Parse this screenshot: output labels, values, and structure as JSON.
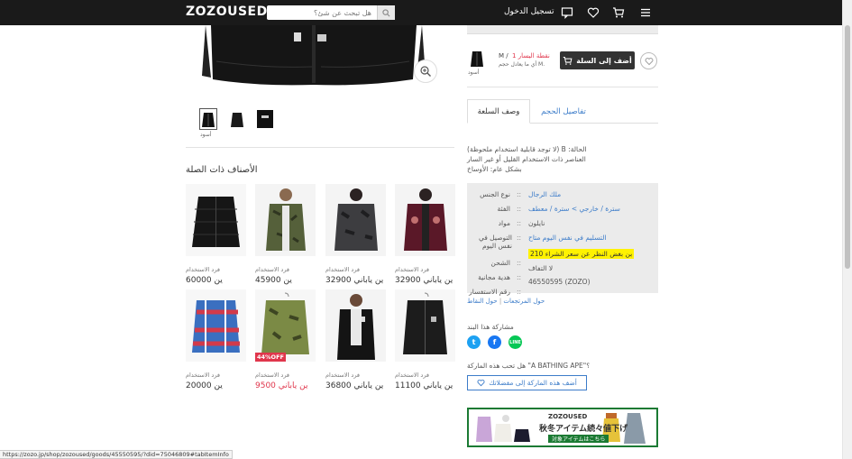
{
  "header": {
    "logo": "ZOZOUSED",
    "search_placeholder": "هل تبحث عن شئ؟",
    "login": "تسجيل الدخول"
  },
  "product": {
    "selected_color": "أسود",
    "size": "M /",
    "points": "1 نقطة اليسار",
    "fit_note": "أي ما يعادل حجم M.",
    "add_to_cart": "أضف إلى السلة"
  },
  "tabs": {
    "size_details": "تفاصيل الحجم",
    "description": "وصف السلعة"
  },
  "description": {
    "line1": "(لا توجد قابلية استخدام ملحوظة) B :الحالة",
    "line2": "العناصر ذات الاستخدام القليل أو غير السار",
    "line3": "بشكل عام: الأوساخ"
  },
  "info": [
    {
      "key": "نوع الجنس",
      "value": "ملك الرجال",
      "link": true
    },
    {
      "key": "الفئة",
      "value": "سترة / خارجي  >  سترة / معطف",
      "link": true
    },
    {
      "key": "مواد",
      "value": "نايلون",
      "link": false
    },
    {
      "key": "التوصيل في نفس اليوم",
      "value": "التسليم في نفس اليوم متاح",
      "link": true
    },
    {
      "key": "الشحن",
      "value": "210 بن بغض النظر عن سعر الشراء",
      "link": false,
      "highlight": true
    },
    {
      "key": "هدية مجانية",
      "value": "لا التفاف",
      "link": false
    },
    {
      "key": "رقم الاستفسار",
      "value": "46550595 (ZOZO)",
      "link": false
    }
  ],
  "small_links": {
    "returns": "حول المرتجعات",
    "points": "حول النقاط"
  },
  "share": {
    "label": "مشاركة هذا البند"
  },
  "brand": {
    "question": "هل تحب هذه الماركة \"A BATHING APE\"؟",
    "add_favorite": "أضف هذه الماركة إلى مفضلاتك"
  },
  "related": {
    "title": "الأصناف ذات الصلة",
    "items": [
      {
        "condition": "فرد الاستخدام",
        "price": "60000 ين",
        "sale": false,
        "badge": ""
      },
      {
        "condition": "فرد الاستخدام",
        "price": "45900 ين",
        "sale": false,
        "badge": ""
      },
      {
        "condition": "فرد الاستخدام",
        "price": "32900 ين ياباني",
        "sale": false,
        "badge": ""
      },
      {
        "condition": "فرد الاستخدام",
        "price": "32900 ين ياباني",
        "sale": false,
        "badge": ""
      },
      {
        "condition": "فرد الاستخدام",
        "price": "20000 ين",
        "sale": false,
        "badge": ""
      },
      {
        "condition": "فرد الاستخدام",
        "price": "9500 ين ياباني",
        "sale": true,
        "badge": "44%OFF"
      },
      {
        "condition": "فرد الاستخدام",
        "price": "36800 ين ياباني",
        "sale": false,
        "badge": ""
      },
      {
        "condition": "فرد الاستخدام",
        "price": "11100 ين ياباني",
        "sale": false,
        "badge": ""
      }
    ]
  },
  "banner": {
    "brand": "ZOZOUSED",
    "headline": "秋冬アイテム続々値下げ",
    "cta": "対象アイテムはこちら"
  },
  "status_url": "https://zozo.jp/shop/zozoused/goods/45550595/?did=75046809#tabItemInfo",
  "colors": {
    "accent": "#3c7cc9",
    "sale": "#e0364c",
    "header": "#1a1a1a",
    "banner": "#1b7a33"
  }
}
